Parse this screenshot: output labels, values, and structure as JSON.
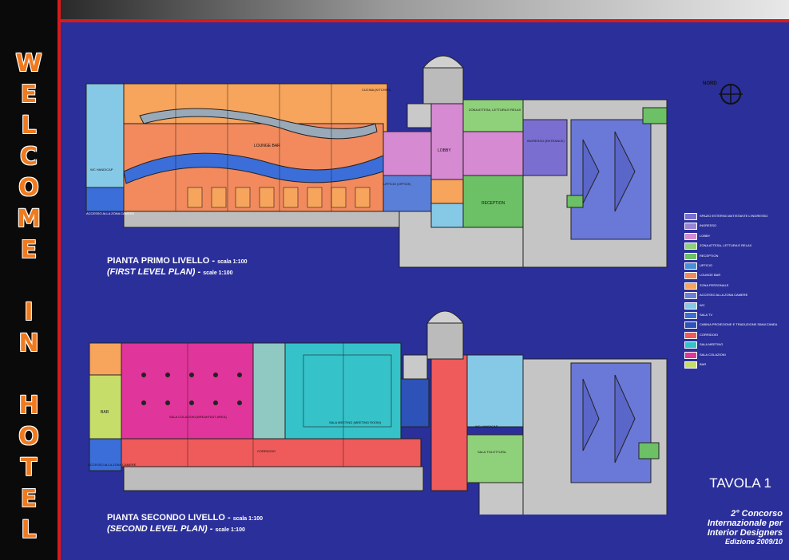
{
  "sidebar_letters": [
    "W",
    "E",
    "L",
    "C",
    "O",
    "M",
    "E",
    "",
    "I",
    "N",
    "",
    "H",
    "O",
    "T",
    "E",
    "L"
  ],
  "colors": {
    "background": "#2b2f9a",
    "accent_red": "#d91a1a",
    "orange": "#f7a45c",
    "salmon": "#f28a5e",
    "lilac": "#d58ad2",
    "green": "#8fd07a",
    "cyan": "#35c2c9",
    "magenta": "#e0359a",
    "red": "#ef5a5a",
    "lightblue": "#86c9e6",
    "purple": "#7a6fd0"
  },
  "north_label": "NORD",
  "plan1": {
    "title": "PIANTA PRIMO LIVELLO -",
    "scale": "scala 1:100",
    "subtitle": "(FIRST LEVEL PLAN) -",
    "subscale": "scale 1:100",
    "labels": {
      "lounge": "LOUNGE BAR",
      "lobby": "LOBBY",
      "reception": "RECEPTION",
      "waiting": "ZONA ATTESA, LETTURA E RELAX",
      "entrance": "INGRESSO (ENTRANCE)",
      "office": "UFFICIO (OFFICE)",
      "kitchen": "CUCINA (KITCHEN)",
      "wc": "WC HANDICAP",
      "rooms": "ACCESSO ALLA ZONA CAMERE"
    }
  },
  "plan2": {
    "title": "PIANTA SECONDO LIVELLO -",
    "scale": "scala 1:100",
    "subtitle": "(SECOND LEVEL PLAN) -",
    "subscale": "scale 1:100",
    "labels": {
      "breakfast": "SALA COLAZIONI (BREAKFAST AREA)",
      "meeting": "SALA MEETING (MEETING ROOM)",
      "corridor": "CORRIDOIO",
      "bar": "BAR",
      "tv": "SALA TV/LETTURA",
      "wc": "WC HANDICAP",
      "rooms": "ACCESSO ALLA ZONA CAMERE"
    }
  },
  "legend": [
    {
      "color": "#7a6fd0",
      "label": "SPAZIO ESTERNO ANTISTANTE L'INGRESSO"
    },
    {
      "color": "#9b84d6",
      "label": "INGRESSO"
    },
    {
      "color": "#d58ad2",
      "label": "LOBBY"
    },
    {
      "color": "#8fd07a",
      "label": "ZONA ATTESA, LETTURA E RELAX"
    },
    {
      "color": "#6cc065",
      "label": "RECEPTION"
    },
    {
      "color": "#4a8fd6",
      "label": "UFFICIO"
    },
    {
      "color": "#f28a5e",
      "label": "LOUNGE BAR"
    },
    {
      "color": "#f7a45c",
      "label": "ZONA PERSONALE"
    },
    {
      "color": "#6a7fd8",
      "label": "ACCESSO ALLA ZONA CAMERE"
    },
    {
      "color": "#86c9e6",
      "label": "WC"
    },
    {
      "color": "#3b6ed8",
      "label": "SALA TV"
    },
    {
      "color": "#2d52b8",
      "label": "CABINA PROIEZIONE E TRADUZIONE SIMULTANEA"
    },
    {
      "color": "#ef5a5a",
      "label": "CORRIDOIO"
    },
    {
      "color": "#35c2c9",
      "label": "SALA MEETING"
    },
    {
      "color": "#e0359a",
      "label": "SALA COLAZIONI"
    },
    {
      "color": "#c6dd6a",
      "label": "BAR"
    }
  ],
  "tavola": "TAVOLA 1",
  "contest": [
    "2° Concorso",
    "Internazionale per",
    "Interior Designers",
    "Edizione 2009/10"
  ]
}
